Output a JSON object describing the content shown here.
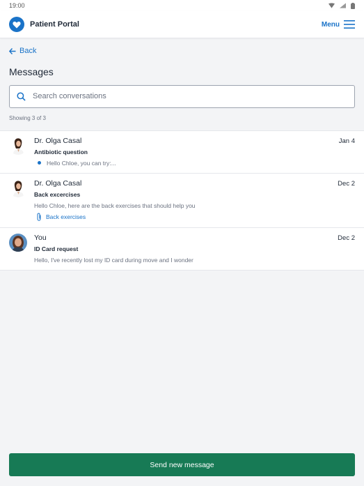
{
  "status_bar": {
    "time": "19:00"
  },
  "header": {
    "title": "Patient Portal",
    "menu_label": "Menu"
  },
  "nav": {
    "back_label": "Back"
  },
  "page": {
    "title": "Messages"
  },
  "search": {
    "placeholder": "Search conversations",
    "value": ""
  },
  "results": {
    "count_text": "Showing 3 of 3"
  },
  "conversations": [
    {
      "sender": "Dr. Olga Casal",
      "date": "Jan 4",
      "subject": "Antibiotic question",
      "preview": "Hello Chloe, you can try:...",
      "unread": true,
      "avatar": "doctor"
    },
    {
      "sender": "Dr. Olga Casal",
      "date": "Dec 2",
      "subject": "Back excercises",
      "preview": "Hello Chloe, here are the back exercises  that should help you",
      "attachment": "Back exercises",
      "avatar": "doctor"
    },
    {
      "sender": "You",
      "date": "Dec 2",
      "subject": "ID Card request",
      "preview": "Hello, I've recently lost my ID card during move and I wonder",
      "avatar": "patient"
    }
  ],
  "footer": {
    "send_label": "Send new message"
  },
  "colors": {
    "accent": "#1a73c8",
    "primary_button": "#177a55",
    "background": "#f3f4f6"
  }
}
